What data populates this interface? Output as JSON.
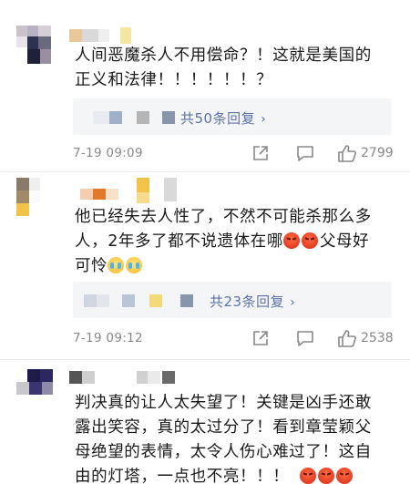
{
  "comments": [
    {
      "text": "人间恶魔杀人不用偿命？！这就是美国的正义和法律！！！！！！？",
      "reply_label": "共50条回复",
      "time": "7-19 09:09",
      "likes": "2799",
      "emojis": []
    },
    {
      "text": "他已经失去人性了，不然不可能杀那么多人，2年多了都不说遗体在哪",
      "text_after": "父母好可怜",
      "reply_label": "共23条回复",
      "time": "7-19 09:12",
      "likes": "2538",
      "emojis": [
        "angry-face",
        "angry-face",
        "crying-face",
        "crying-face"
      ]
    },
    {
      "text": "判决真的让人太失望了！关键是凶手还敢露出笑容，真的太过分了！看到章莹颖父母绝望的表情，太令人伤心难过了！这自由的灯塔，一点也不亮！！！",
      "emojis": [
        "angry-face",
        "angry-face",
        "angry-face"
      ]
    }
  ],
  "icons": {
    "share": "share-icon",
    "comment": "comment-icon",
    "like": "thumbs-up-icon",
    "chevron": "›"
  },
  "colors": {
    "reply_link": "#5b73a8",
    "meta_text": "#888888",
    "reply_bg": "#f4f5f7"
  }
}
